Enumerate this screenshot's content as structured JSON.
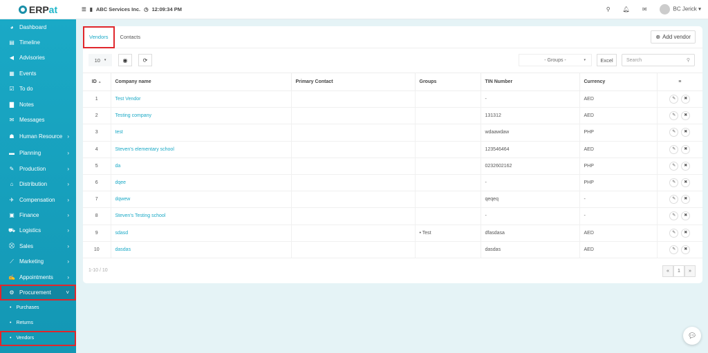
{
  "app": {
    "logo_prefix": "ERP",
    "logo_suffix": "at",
    "company": "ABC Services Inc.",
    "time": "12:09:34 PM",
    "user": "BC Jerick"
  },
  "sidebar": {
    "items": [
      {
        "label": "Dashboard",
        "icon": "◕"
      },
      {
        "label": "Timeline",
        "icon": "▤"
      },
      {
        "label": "Advisories",
        "icon": "◀"
      },
      {
        "label": "Events",
        "icon": "▦"
      },
      {
        "label": "To do",
        "icon": "☑"
      },
      {
        "label": "Notes",
        "icon": "▇"
      },
      {
        "label": "Messages",
        "icon": "✉"
      },
      {
        "label": "Human Resource",
        "icon": "☗",
        "chev": "›"
      },
      {
        "label": "Planning",
        "icon": "▬",
        "chev": "›"
      },
      {
        "label": "Production",
        "icon": "✎",
        "chev": "›"
      },
      {
        "label": "Distribution",
        "icon": "⌂",
        "chev": "›"
      },
      {
        "label": "Compensation",
        "icon": "✈",
        "chev": "›"
      },
      {
        "label": "Finance",
        "icon": "▣",
        "chev": "›"
      },
      {
        "label": "Logistics",
        "icon": "⛟",
        "chev": "›"
      },
      {
        "label": "Sales",
        "icon": "⛒",
        "chev": "›"
      },
      {
        "label": "Marketing",
        "icon": "⟋",
        "chev": "›"
      },
      {
        "label": "Appointments",
        "icon": "✍",
        "chev": "›"
      },
      {
        "label": "Procurement",
        "icon": "⚙",
        "chev": "˅"
      }
    ],
    "sub": [
      "Purchases",
      "Returns",
      "Vendors"
    ]
  },
  "tabs": {
    "vendors": "Vendors",
    "contacts": "Contacts",
    "add": "Add vendor"
  },
  "toolbar": {
    "page_length": "10",
    "groups": "- Groups -",
    "excel": "Excel",
    "search_placeholder": "Search"
  },
  "table": {
    "headers": [
      "ID",
      "Company name",
      "Primary Contact",
      "Groups",
      "TIN Number",
      "Currency"
    ],
    "rows": [
      [
        "1",
        "Test Vendor",
        "",
        "",
        "-",
        "AED"
      ],
      [
        "2",
        "Testing company",
        "",
        "",
        "131312",
        "AED"
      ],
      [
        "3",
        "test",
        "",
        "",
        "wdaawdaw",
        "PHP"
      ],
      [
        "4",
        "Steven's elementary school",
        "",
        "",
        "123546464",
        "AED"
      ],
      [
        "5",
        "da",
        "",
        "",
        "0232602162",
        "PHP"
      ],
      [
        "6",
        "dqee",
        "",
        "",
        "-",
        "PHP"
      ],
      [
        "7",
        "dqwew",
        "",
        "",
        "qeqeq",
        "-"
      ],
      [
        "8",
        "Steven's Testing school",
        "",
        "",
        "-",
        "-"
      ],
      [
        "9",
        "sdasd",
        "",
        "• Test",
        "dfasdasa",
        "AED"
      ],
      [
        "10",
        "dasdas",
        "",
        "",
        "dasdas",
        "AED"
      ]
    ]
  },
  "footer": {
    "range": "1-10 / 10",
    "prev": "«",
    "page": "1",
    "next": "»"
  }
}
